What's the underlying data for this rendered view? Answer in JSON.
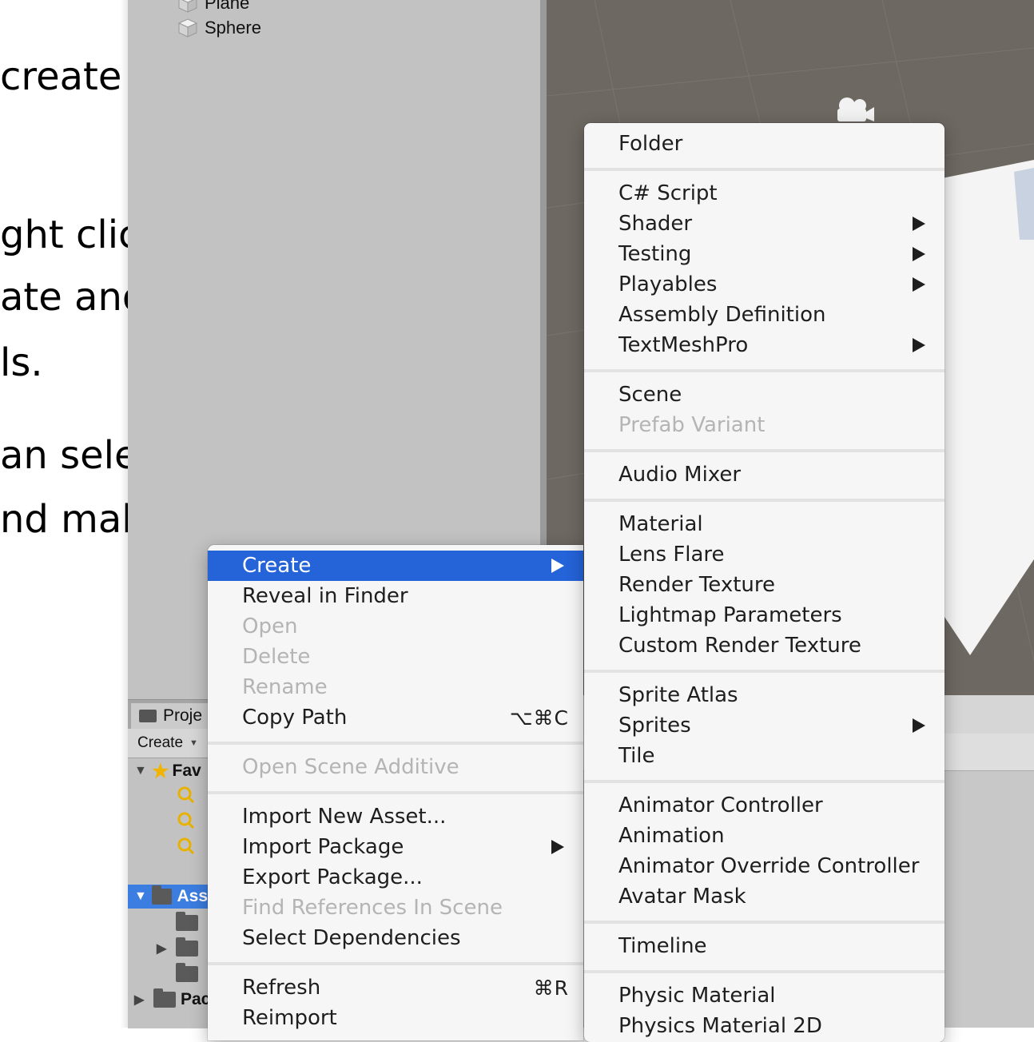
{
  "document": {
    "lines": [
      "create a",
      "ght click",
      "ate and",
      "ls.",
      "an select",
      "nd make"
    ]
  },
  "hierarchy": {
    "items": [
      {
        "label": "Plane"
      },
      {
        "label": "Sphere"
      }
    ]
  },
  "project": {
    "tab_label": "Proje",
    "create_label": "Create",
    "favorites_label": "Fav",
    "assets_label": "Ass",
    "packages_label": "Pac"
  },
  "context_menu": {
    "items": [
      {
        "label": "Create",
        "state": "active",
        "submenu": true
      },
      {
        "label": "Reveal in Finder",
        "state": "enabled"
      },
      {
        "label": "Open",
        "state": "disabled"
      },
      {
        "label": "Delete",
        "state": "disabled"
      },
      {
        "label": "Rename",
        "state": "disabled"
      },
      {
        "label": "Copy Path",
        "state": "enabled",
        "shortcut": "⌥⌘C"
      },
      {
        "label": "Open Scene Additive",
        "state": "disabled"
      },
      {
        "label": "Import New Asset...",
        "state": "enabled"
      },
      {
        "label": "Import Package",
        "state": "enabled",
        "submenu": true
      },
      {
        "label": "Export Package...",
        "state": "enabled"
      },
      {
        "label": "Find References In Scene",
        "state": "disabled"
      },
      {
        "label": "Select Dependencies",
        "state": "enabled"
      },
      {
        "label": "Refresh",
        "state": "enabled",
        "shortcut": "⌘R"
      },
      {
        "label": "Reimport",
        "state": "enabled"
      }
    ]
  },
  "create_submenu": {
    "items": [
      {
        "label": "Folder",
        "state": "enabled"
      },
      {
        "label": "C# Script",
        "state": "enabled"
      },
      {
        "label": "Shader",
        "state": "enabled",
        "submenu": true
      },
      {
        "label": "Testing",
        "state": "enabled",
        "submenu": true
      },
      {
        "label": "Playables",
        "state": "enabled",
        "submenu": true
      },
      {
        "label": "Assembly Definition",
        "state": "enabled"
      },
      {
        "label": "TextMeshPro",
        "state": "enabled",
        "submenu": true
      },
      {
        "label": "Scene",
        "state": "enabled"
      },
      {
        "label": "Prefab Variant",
        "state": "disabled"
      },
      {
        "label": "Audio Mixer",
        "state": "enabled"
      },
      {
        "label": "Material",
        "state": "enabled"
      },
      {
        "label": "Lens Flare",
        "state": "enabled"
      },
      {
        "label": "Render Texture",
        "state": "enabled"
      },
      {
        "label": "Lightmap Parameters",
        "state": "enabled"
      },
      {
        "label": "Custom Render Texture",
        "state": "enabled"
      },
      {
        "label": "Sprite Atlas",
        "state": "enabled"
      },
      {
        "label": "Sprites",
        "state": "enabled",
        "submenu": true
      },
      {
        "label": "Tile",
        "state": "enabled"
      },
      {
        "label": "Animator Controller",
        "state": "enabled"
      },
      {
        "label": "Animation",
        "state": "enabled"
      },
      {
        "label": "Animator Override Controller",
        "state": "enabled"
      },
      {
        "label": "Avatar Mask",
        "state": "enabled"
      },
      {
        "label": "Timeline",
        "state": "enabled"
      },
      {
        "label": "Physic Material",
        "state": "enabled"
      },
      {
        "label": "Physics Material 2D",
        "state": "enabled"
      }
    ]
  },
  "colors": {
    "menu_highlight": "#2463d8",
    "selection": "#3b7de0",
    "disabled_text": "#b4b4b4"
  }
}
